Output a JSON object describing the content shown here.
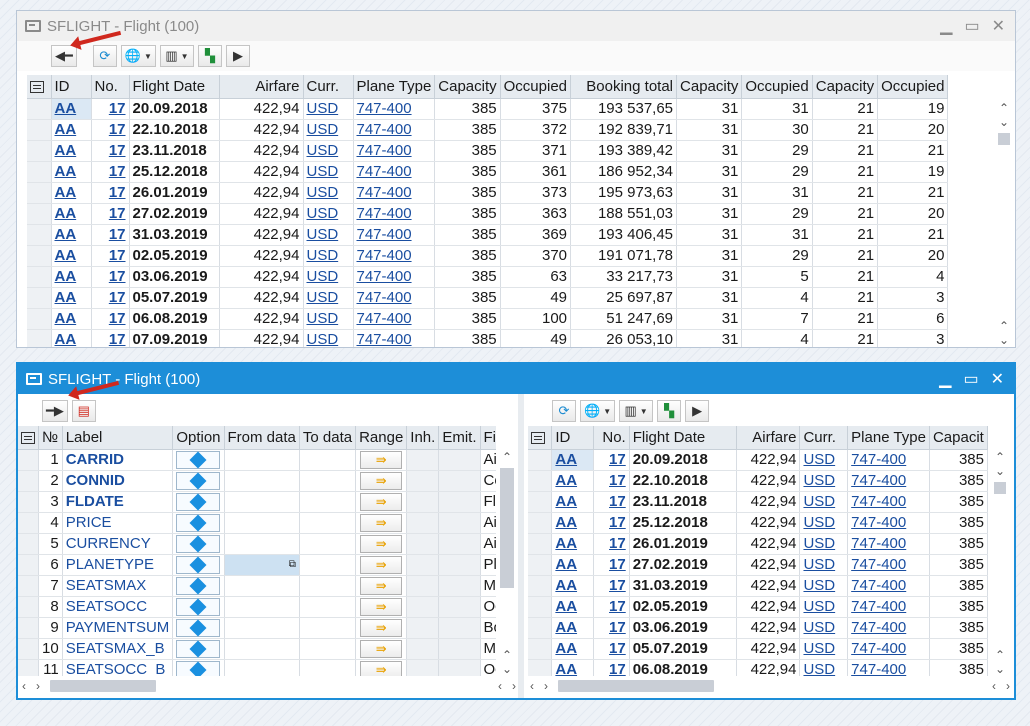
{
  "window1": {
    "title": "SFLIGHT - Flight (100)",
    "columns": [
      "ID",
      "No.",
      "Flight Date",
      "Airfare",
      "Curr.",
      "Plane Type",
      "Capacity",
      "Occupied",
      "Booking total",
      "Capacity",
      "Occupied",
      "Capacity",
      "Occupied"
    ],
    "rows": [
      [
        "AA",
        "17",
        "20.09.2018",
        "422,94",
        "USD",
        "747-400",
        "385",
        "375",
        "193 537,65",
        "31",
        "31",
        "21",
        "19"
      ],
      [
        "AA",
        "17",
        "22.10.2018",
        "422,94",
        "USD",
        "747-400",
        "385",
        "372",
        "192 839,71",
        "31",
        "30",
        "21",
        "20"
      ],
      [
        "AA",
        "17",
        "23.11.2018",
        "422,94",
        "USD",
        "747-400",
        "385",
        "371",
        "193 389,42",
        "31",
        "29",
        "21",
        "21"
      ],
      [
        "AA",
        "17",
        "25.12.2018",
        "422,94",
        "USD",
        "747-400",
        "385",
        "361",
        "186 952,34",
        "31",
        "29",
        "21",
        "19"
      ],
      [
        "AA",
        "17",
        "26.01.2019",
        "422,94",
        "USD",
        "747-400",
        "385",
        "373",
        "195 973,63",
        "31",
        "31",
        "21",
        "21"
      ],
      [
        "AA",
        "17",
        "27.02.2019",
        "422,94",
        "USD",
        "747-400",
        "385",
        "363",
        "188 551,03",
        "31",
        "29",
        "21",
        "20"
      ],
      [
        "AA",
        "17",
        "31.03.2019",
        "422,94",
        "USD",
        "747-400",
        "385",
        "369",
        "193 406,45",
        "31",
        "31",
        "21",
        "21"
      ],
      [
        "AA",
        "17",
        "02.05.2019",
        "422,94",
        "USD",
        "747-400",
        "385",
        "370",
        "191 071,78",
        "31",
        "29",
        "21",
        "20"
      ],
      [
        "AA",
        "17",
        "03.06.2019",
        "422,94",
        "USD",
        "747-400",
        "385",
        "63",
        "33 217,73",
        "31",
        "5",
        "21",
        "4"
      ],
      [
        "AA",
        "17",
        "05.07.2019",
        "422,94",
        "USD",
        "747-400",
        "385",
        "49",
        "25 697,87",
        "31",
        "4",
        "21",
        "3"
      ],
      [
        "AA",
        "17",
        "06.08.2019",
        "422,94",
        "USD",
        "747-400",
        "385",
        "100",
        "51 247,69",
        "31",
        "7",
        "21",
        "6"
      ],
      [
        "AA",
        "17",
        "07.09.2019",
        "422,94",
        "USD",
        "747-400",
        "385",
        "49",
        "26 053,10",
        "31",
        "4",
        "21",
        "3"
      ]
    ]
  },
  "window2": {
    "title": "SFLIGHT - Flight (100)",
    "left_columns": [
      "№",
      "Label",
      "Option",
      "From data",
      "To data",
      "Range",
      "Inh.",
      "Emit.",
      "Field"
    ],
    "left_rows": [
      [
        "1",
        "CARRID",
        "Airlin"
      ],
      [
        "2",
        "CONNID",
        "Conn"
      ],
      [
        "3",
        "FLDATE",
        "Fligh"
      ],
      [
        "4",
        "PRICE",
        "Airfa"
      ],
      [
        "5",
        "CURRENCY",
        "Airlin"
      ],
      [
        "6",
        "PLANETYPE",
        "Plane"
      ],
      [
        "7",
        "SEATSMAX",
        "Max"
      ],
      [
        "8",
        "SEATSOCC",
        "Occu"
      ],
      [
        "9",
        "PAYMENTSUM",
        "Book"
      ],
      [
        "10",
        "SEATSMAX_B",
        "Max"
      ],
      [
        "11",
        "SEATSOCC_B",
        "Occu"
      ]
    ],
    "right_columns": [
      "ID",
      "No.",
      "Flight Date",
      "Airfare",
      "Curr.",
      "Plane Type",
      "Capacit"
    ],
    "right_rows": [
      [
        "AA",
        "17",
        "20.09.2018",
        "422,94",
        "USD",
        "747-400",
        "385"
      ],
      [
        "AA",
        "17",
        "22.10.2018",
        "422,94",
        "USD",
        "747-400",
        "385"
      ],
      [
        "AA",
        "17",
        "23.11.2018",
        "422,94",
        "USD",
        "747-400",
        "385"
      ],
      [
        "AA",
        "17",
        "25.12.2018",
        "422,94",
        "USD",
        "747-400",
        "385"
      ],
      [
        "AA",
        "17",
        "26.01.2019",
        "422,94",
        "USD",
        "747-400",
        "385"
      ],
      [
        "AA",
        "17",
        "27.02.2019",
        "422,94",
        "USD",
        "747-400",
        "385"
      ],
      [
        "AA",
        "17",
        "31.03.2019",
        "422,94",
        "USD",
        "747-400",
        "385"
      ],
      [
        "AA",
        "17",
        "02.05.2019",
        "422,94",
        "USD",
        "747-400",
        "385"
      ],
      [
        "AA",
        "17",
        "03.06.2019",
        "422,94",
        "USD",
        "747-400",
        "385"
      ],
      [
        "AA",
        "17",
        "05.07.2019",
        "422,94",
        "USD",
        "747-400",
        "385"
      ],
      [
        "AA",
        "17",
        "06.08.2019",
        "422,94",
        "USD",
        "747-400",
        "385"
      ]
    ]
  },
  "colors": {
    "accent": "#1d8ed8",
    "link": "#1a4ea0",
    "annotation_arrow": "#d0281e"
  }
}
